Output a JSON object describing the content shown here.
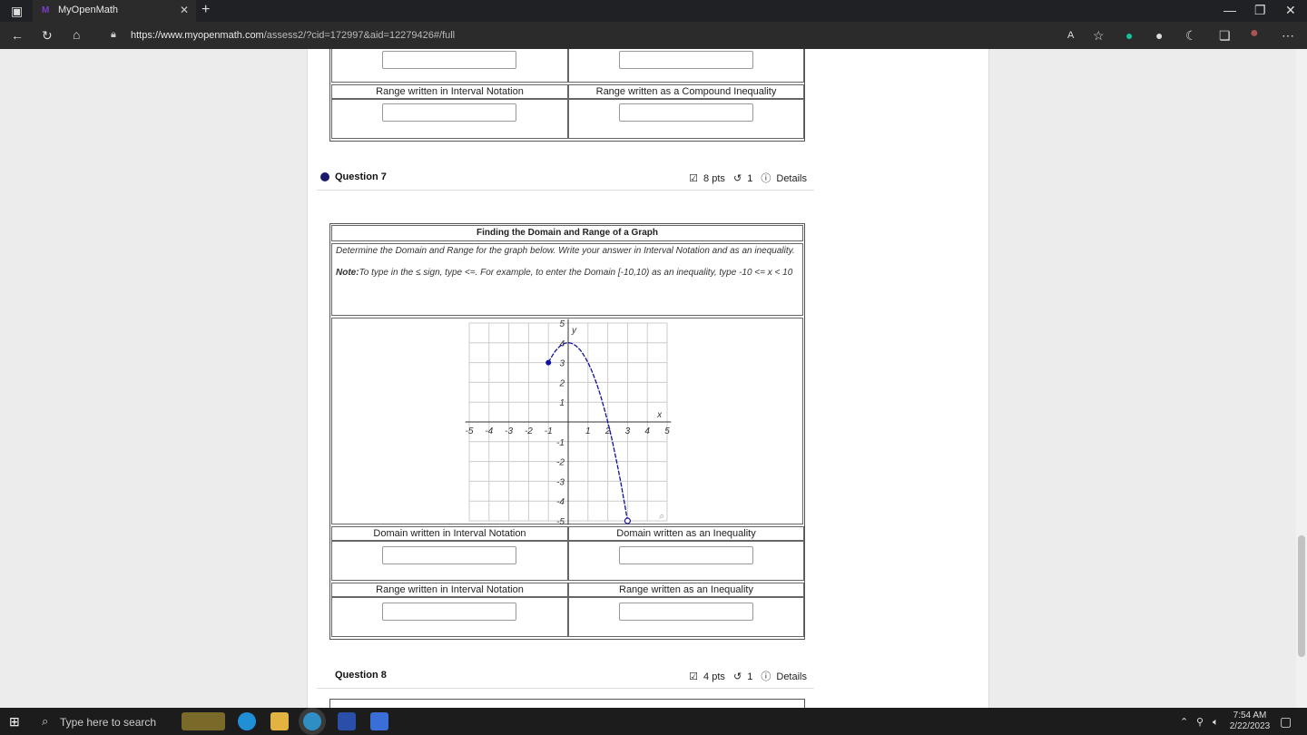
{
  "browser": {
    "tab_title": "MyOpenMath",
    "url_host": "https://www.myopenmath.com",
    "url_path": "/assess2/?cid=172997&aid=12279426#/full"
  },
  "q6_tail": {
    "range_interval_label": "Range written in Interval Notation",
    "range_compound_label": "Range written as a Compound Inequality"
  },
  "question7": {
    "label": "Question 7",
    "points": "8 pts",
    "tries": "1",
    "details": "Details",
    "table_title": "Finding the Domain and Range of a Graph",
    "instruction": "Determine the Domain and Range for the graph below. Write your answer in Interval Notation and as an inequality.",
    "note_label": "Note:",
    "note_text": "To type in the ≤ sign, type <=. For example, to enter the Domain [-10,10) as an inequality, type -10 <= x < 10",
    "domain_interval_label": "Domain written in Interval Notation",
    "domain_inequality_label": "Domain written as an Inequality",
    "range_interval_label": "Range written in Interval Notation",
    "range_inequality_label": "Range written as an Inequality"
  },
  "question8": {
    "label": "Question 8",
    "points": "4 pts",
    "tries": "1",
    "details": "Details"
  },
  "graph": {
    "x_label": "x",
    "y_label": "y",
    "x_ticks": [
      "-5",
      "-4",
      "-3",
      "-2",
      "-1",
      "1",
      "2",
      "3",
      "4",
      "5"
    ],
    "y_ticks": [
      "5",
      "4",
      "3",
      "2",
      "1",
      "-1",
      "-2",
      "-3",
      "-4",
      "-5"
    ],
    "start_point": {
      "x": -1,
      "y": 3,
      "closed": true
    },
    "vertex": {
      "x": 0,
      "y": 4
    },
    "end_point": {
      "x": 3,
      "y": -5,
      "closed": false
    },
    "curve_color": "#1010a0"
  },
  "taskbar": {
    "search_placeholder": "Type here to search",
    "time": "7:54 AM",
    "date": "2/22/2023"
  }
}
